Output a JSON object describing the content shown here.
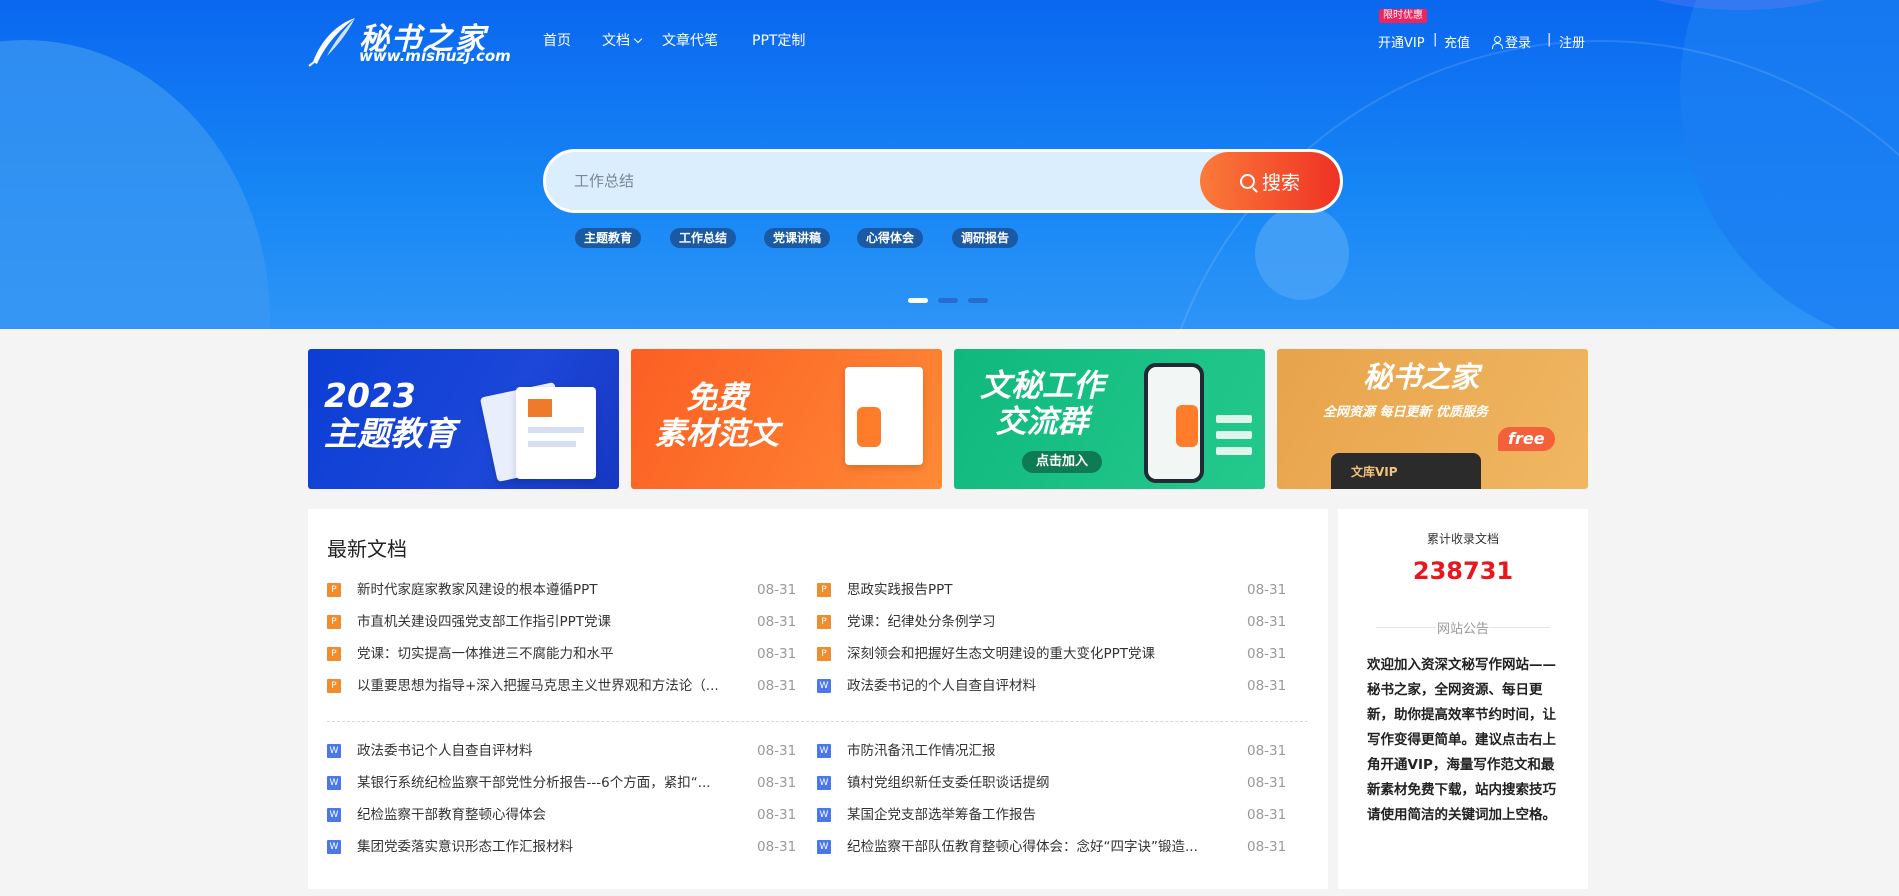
{
  "logo": {
    "brand": "秘书之家",
    "url": "www.mishuzj.com"
  },
  "nav": {
    "home": "首页",
    "docs": "文档",
    "ghostwriting": "文章代笔",
    "ppt": "PPT定制"
  },
  "account": {
    "promo_badge": "限时优惠",
    "vip": "开通VIP",
    "recharge": "充值",
    "login": "登录",
    "register": "注册",
    "separator": "|"
  },
  "search": {
    "placeholder": "工作总结",
    "button": "搜索"
  },
  "hot_tags": [
    "主题教育",
    "工作总结",
    "党课讲稿",
    "心得体会",
    "调研报告"
  ],
  "banners": {
    "b1": {
      "line1": "2023",
      "line2": "主题教育"
    },
    "b2": {
      "line1": "免费",
      "line2": "素材范文"
    },
    "b3": {
      "line1": "文秘工作",
      "line2": "交流群",
      "pill": "点击加入"
    },
    "b4": {
      "line1": "秘书之家",
      "sub": "全网资源 每日更新 优质服务",
      "free": "free",
      "vip": "文库VIP"
    }
  },
  "latest": {
    "title": "最新文档",
    "top": [
      {
        "type": "P",
        "title": "新时代家庭家教家风建设的根本遵循PPT",
        "date": "08-31"
      },
      {
        "type": "P",
        "title": "思政实践报告PPT",
        "date": "08-31"
      },
      {
        "type": "P",
        "title": "市直机关建设四强党支部工作指引PPT党课",
        "date": "08-31"
      },
      {
        "type": "P",
        "title": "党课：纪律处分条例学习",
        "date": "08-31"
      },
      {
        "type": "P",
        "title": "党课：切实提高一体推进三不腐能力和水平",
        "date": "08-31"
      },
      {
        "type": "P",
        "title": "深刻领会和把握好生态文明建设的重大变化PPT党课",
        "date": "08-31"
      },
      {
        "type": "P",
        "title": "以重要思想为指导+深入把握马克思主义世界观和方法论（...",
        "date": "08-31"
      },
      {
        "type": "W",
        "title": "政法委书记的个人自查自评材料",
        "date": "08-31"
      }
    ],
    "bottom": [
      {
        "type": "W",
        "title": "政法委书记个人自查自评材料",
        "date": "08-31"
      },
      {
        "type": "W",
        "title": "市防汛备汛工作情况汇报",
        "date": "08-31"
      },
      {
        "type": "W",
        "title": "某银行系统纪检监察干部党性分析报告---6个方面，紧扣“...",
        "date": "08-31"
      },
      {
        "type": "W",
        "title": "镇村党组织新任支委任职谈话提纲",
        "date": "08-31"
      },
      {
        "type": "W",
        "title": "纪检监察干部教育整顿心得体会",
        "date": "08-31"
      },
      {
        "type": "W",
        "title": "某国企党支部选举筹备工作报告",
        "date": "08-31"
      },
      {
        "type": "W",
        "title": "集团党委落实意识形态工作汇报材料",
        "date": "08-31"
      },
      {
        "type": "W",
        "title": "纪检监察干部队伍教育整顿心得体会：念好“四字诀”锻造...",
        "date": "08-31"
      }
    ]
  },
  "side": {
    "label": "累计收录文档",
    "count": "238731",
    "notice_title": "网站公告",
    "notice_text": "欢迎加入资深文秘写作网站——秘书之家，全网资源、每日更新，助你提高效率节约时间，让写作变得更简单。建议点击右上角开通VIP，海量写作范文和最新素材免费下载，站内搜索技巧请使用简洁的关键词加上空格。"
  },
  "colors": {
    "hero_blue": "#0a67f0",
    "search_btn": "#ef3124",
    "count_red": "#e8161f"
  }
}
